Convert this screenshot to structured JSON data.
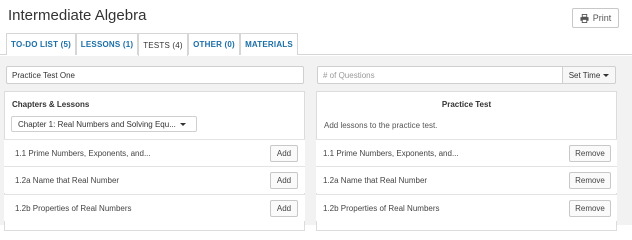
{
  "header": {
    "title": "Intermediate Algebra",
    "print_label": "Print"
  },
  "tabs": [
    {
      "label": "TO-DO LIST (5)",
      "active": false
    },
    {
      "label": "LESSONS (1)",
      "active": false
    },
    {
      "label": "TESTS (4)",
      "active": true
    },
    {
      "label": "OTHER (0)",
      "active": false
    },
    {
      "label": "MATERIALS",
      "active": false
    }
  ],
  "test_name": {
    "value": "Practice Test One"
  },
  "questions": {
    "placeholder": "# of Questions"
  },
  "set_time": {
    "label": "Set Time"
  },
  "left_panel": {
    "title": "Chapters & Lessons",
    "chapter_select": "Chapter 1: Real Numbers and Solving Equ...",
    "lessons": [
      {
        "label": "1.1 Prime Numbers, Exponents, and...",
        "button": "Add"
      },
      {
        "label": "1.2a Name that Real Number",
        "button": "Add"
      },
      {
        "label": "1.2b Properties of Real Numbers",
        "button": "Add"
      }
    ]
  },
  "right_panel": {
    "title": "Practice Test",
    "hint": "Add lessons to the practice test.",
    "lessons": [
      {
        "label": "1.1 Prime Numbers, Exponents, and...",
        "button": "Remove"
      },
      {
        "label": "1.2a Name that Real Number",
        "button": "Remove"
      },
      {
        "label": "1.2b Properties of Real Numbers",
        "button": "Remove"
      }
    ]
  }
}
